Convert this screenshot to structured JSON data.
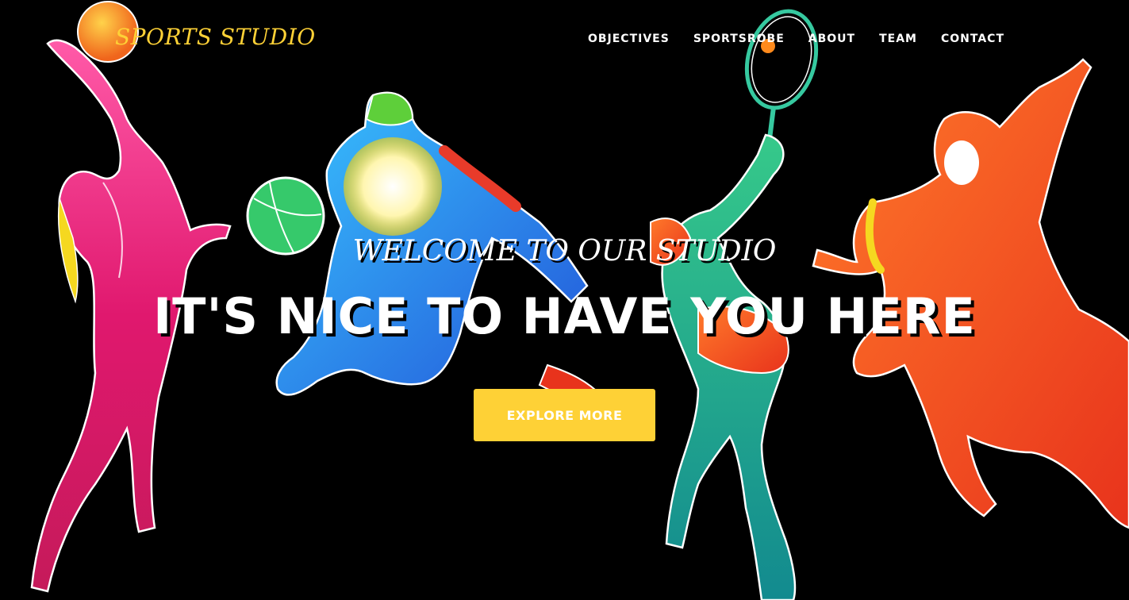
{
  "brand": {
    "name": "SPORTS STUDIO",
    "color": "#fed136"
  },
  "nav": {
    "items": [
      {
        "label": "OBJECTIVES"
      },
      {
        "label": "SPORTSROBE"
      },
      {
        "label": "ABOUT"
      },
      {
        "label": "TEAM"
      },
      {
        "label": "CONTACT"
      }
    ]
  },
  "hero": {
    "lead": "WELCOME TO OUR STUDIO",
    "heading": "IT'S NICE TO HAVE YOU HERE",
    "button_label": "EXPLORE MORE",
    "button_color": "#fed136",
    "background": "#000000",
    "image_subject": "colorful silhouettes of athletes: volleyball server, basketball player, tennis player, runner"
  }
}
